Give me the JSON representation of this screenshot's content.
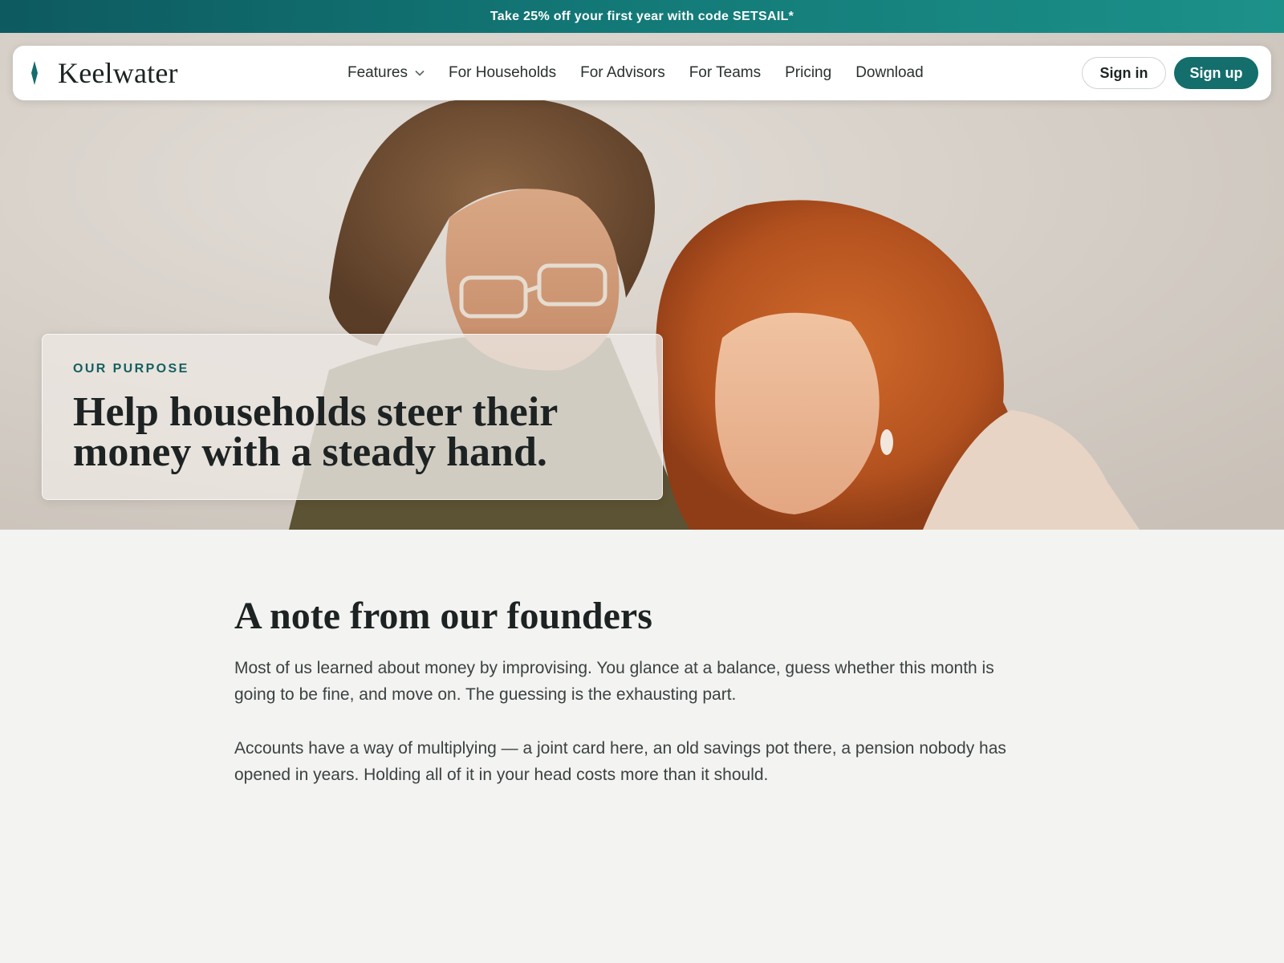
{
  "promo": {
    "text": "Take 25% off your first year with code SETSAIL*"
  },
  "navbar": {
    "brand": "Keelwater",
    "links": [
      {
        "label": "Features",
        "has_dropdown": true
      },
      {
        "label": "For Households"
      },
      {
        "label": "For Advisors"
      },
      {
        "label": "For Teams"
      },
      {
        "label": "Pricing"
      },
      {
        "label": "Download"
      }
    ],
    "sign_in": "Sign in",
    "sign_up": "Sign up"
  },
  "hero": {
    "eyebrow": "OUR PURPOSE",
    "title": "Help households steer their money with a steady hand."
  },
  "note": {
    "title": "A note from our founders",
    "paragraphs": [
      "Most of us learned about money by improvising. You glance at a balance, guess whether this month is going to be fine, and move on. The guessing is the exhausting part.",
      "Accounts have a way of multiplying — a joint card here, an old savings pot there, a pension nobody has opened in years. Holding all of it in your head costs more than it should."
    ]
  },
  "colors": {
    "brand_teal": "#136e6c",
    "banner_gradient_start": "#0d5a60",
    "banner_gradient_end": "#1c918a",
    "page_background": "#f3f3f1"
  },
  "icons": {
    "brand_mark": "keel-icon",
    "dropdown": "chevron-down-icon"
  }
}
